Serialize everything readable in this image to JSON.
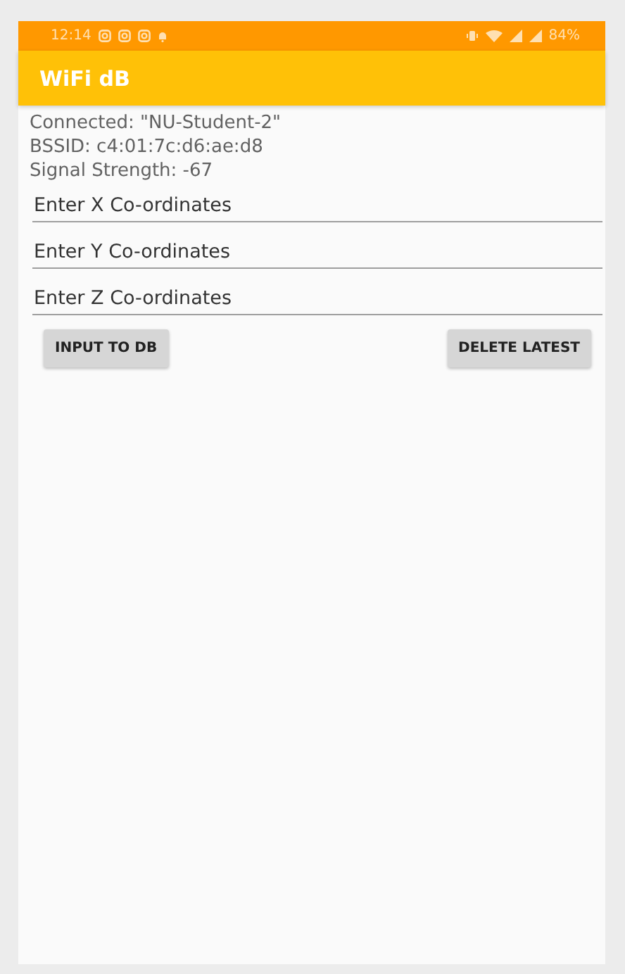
{
  "status_bar": {
    "time": "12:14",
    "battery": "84%"
  },
  "app_bar": {
    "title": "WiFi dB"
  },
  "info": [
    "Connected: \"NU-Student-2\"",
    "BSSID: c4:01:7c:d6:ae:d8",
    "Signal Strength: -67"
  ],
  "fields": [
    {
      "placeholder": "Enter X Co-ordinates"
    },
    {
      "placeholder": "Enter Y Co-ordinates"
    },
    {
      "placeholder": "Enter Z Co-ordinates"
    }
  ],
  "buttons": [
    "INPUT TO DB",
    "DELETE LATEST"
  ]
}
